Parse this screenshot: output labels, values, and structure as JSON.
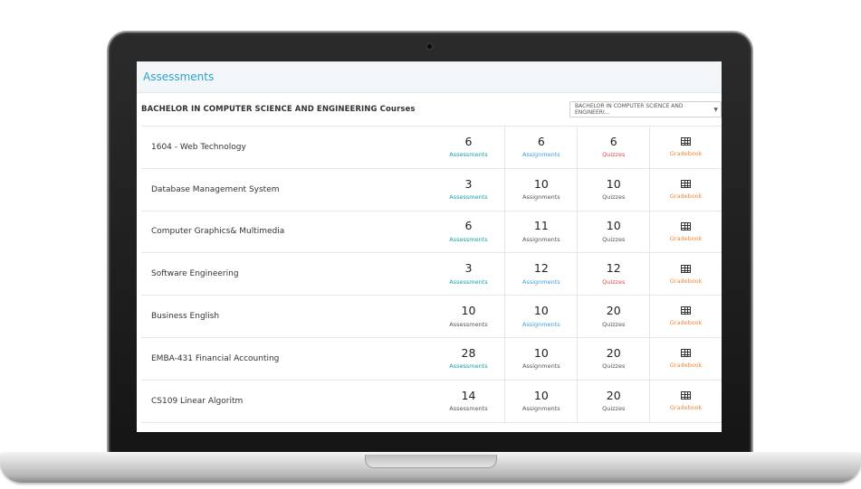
{
  "header": {
    "title": "Assessments"
  },
  "subbar": {
    "title": "BACHELOR IN COMPUTER SCIENCE AND ENGINEERING Courses",
    "program_select": "BACHELOR IN COMPUTER SCIENCE AND ENGINEERI..."
  },
  "colors": {
    "header_title": "#2aa3c9",
    "label_teal": "#17a2a2",
    "label_blue": "#3e9be0",
    "label_red": "#e5484d",
    "label_orange": "#f0883a"
  },
  "courses": [
    {
      "name": "1604 - Web Technology",
      "assessments": {
        "value": "6",
        "label": "Assessments",
        "color": "teal"
      },
      "assignments": {
        "value": "6",
        "label": "Assignments",
        "color": "blue"
      },
      "quizzes": {
        "value": "6",
        "label": "Quizzes",
        "color": "red"
      },
      "gradebook": {
        "label": "Gradebook",
        "icon": "table-icon"
      }
    },
    {
      "name": "Database Management System",
      "assessments": {
        "value": "3",
        "label": "Assessments",
        "color": "teal"
      },
      "assignments": {
        "value": "10",
        "label": "Assignments",
        "color": "default"
      },
      "quizzes": {
        "value": "10",
        "label": "Quizzes",
        "color": "default"
      },
      "gradebook": {
        "label": "Gradebook",
        "icon": "table-icon"
      }
    },
    {
      "name": "Computer Graphics& Multimedia",
      "assessments": {
        "value": "6",
        "label": "Assessments",
        "color": "teal"
      },
      "assignments": {
        "value": "11",
        "label": "Assignments",
        "color": "default"
      },
      "quizzes": {
        "value": "10",
        "label": "Quizzes",
        "color": "default"
      },
      "gradebook": {
        "label": "Gradebook",
        "icon": "table-icon"
      }
    },
    {
      "name": "Software Engineering",
      "assessments": {
        "value": "3",
        "label": "Assessments",
        "color": "teal"
      },
      "assignments": {
        "value": "12",
        "label": "Assignments",
        "color": "blue"
      },
      "quizzes": {
        "value": "12",
        "label": "Quizzes",
        "color": "red"
      },
      "gradebook": {
        "label": "Gradebook",
        "icon": "table-icon"
      }
    },
    {
      "name": "Business English",
      "assessments": {
        "value": "10",
        "label": "Assessments",
        "color": "default"
      },
      "assignments": {
        "value": "10",
        "label": "Assignments",
        "color": "blue"
      },
      "quizzes": {
        "value": "20",
        "label": "Quizzes",
        "color": "default"
      },
      "gradebook": {
        "label": "Gradebook",
        "icon": "table-icon"
      }
    },
    {
      "name": "EMBA-431 Financial Accounting",
      "assessments": {
        "value": "28",
        "label": "Assessments",
        "color": "teal"
      },
      "assignments": {
        "value": "10",
        "label": "Assignments",
        "color": "default"
      },
      "quizzes": {
        "value": "20",
        "label": "Quizzes",
        "color": "default"
      },
      "gradebook": {
        "label": "Gradebook",
        "icon": "table-icon"
      }
    },
    {
      "name": "CS109 Linear Algoritm",
      "assessments": {
        "value": "14",
        "label": "Assessments",
        "color": "default"
      },
      "assignments": {
        "value": "10",
        "label": "Assignments",
        "color": "default"
      },
      "quizzes": {
        "value": "20",
        "label": "Quizzes",
        "color": "default"
      },
      "gradebook": {
        "label": "Gradebook",
        "icon": "table-icon"
      }
    }
  ]
}
